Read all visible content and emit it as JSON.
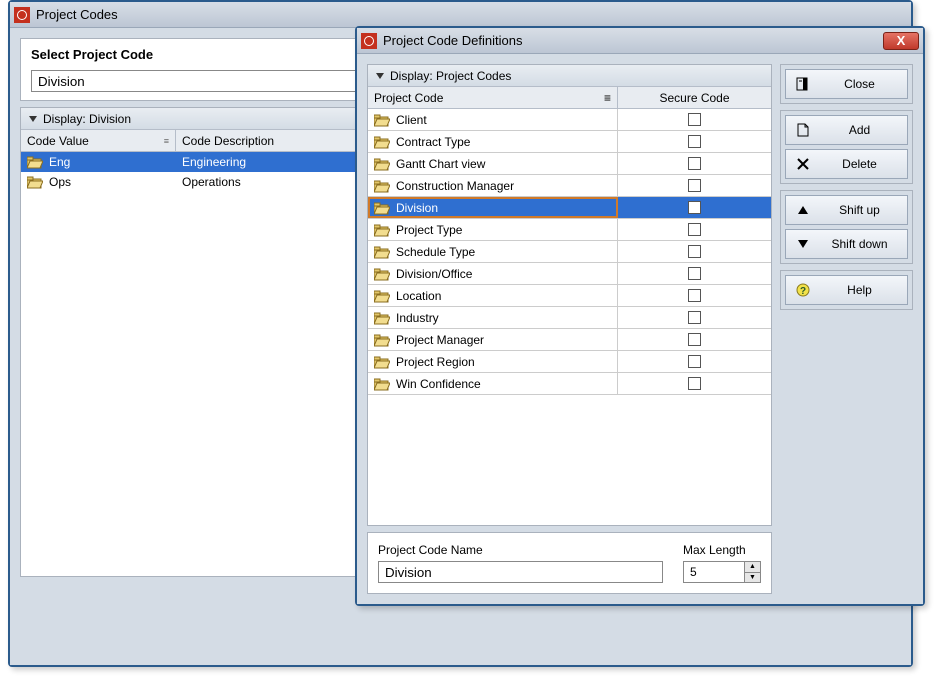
{
  "back_window": {
    "title": "Project Codes",
    "select_label": "Select Project Code",
    "select_value": "Division",
    "display_label": "Display: Division",
    "columns": {
      "value": "Code Value",
      "desc": "Code Description"
    },
    "rows": [
      {
        "value": "Eng",
        "desc": "Engineering",
        "selected": true
      },
      {
        "value": "Ops",
        "desc": "Operations",
        "selected": false
      }
    ]
  },
  "front_window": {
    "title": "Project Code Definitions",
    "close_x": "X",
    "display_label": "Display: Project Codes",
    "columns": {
      "code": "Project Code",
      "secure": "Secure Code"
    },
    "codes": [
      {
        "name": "Client",
        "secure": false,
        "selected": false
      },
      {
        "name": "Contract Type",
        "secure": false,
        "selected": false
      },
      {
        "name": "Gantt Chart view",
        "secure": false,
        "selected": false
      },
      {
        "name": "Construction Manager",
        "secure": false,
        "selected": false
      },
      {
        "name": "Division",
        "secure": false,
        "selected": true
      },
      {
        "name": "Project Type",
        "secure": false,
        "selected": false
      },
      {
        "name": "Schedule Type",
        "secure": false,
        "selected": false
      },
      {
        "name": "Division/Office",
        "secure": false,
        "selected": false
      },
      {
        "name": "Location",
        "secure": false,
        "selected": false
      },
      {
        "name": "Industry",
        "secure": false,
        "selected": false
      },
      {
        "name": "Project Manager",
        "secure": false,
        "selected": false
      },
      {
        "name": "Project Region",
        "secure": false,
        "selected": false
      },
      {
        "name": "Win Confidence",
        "secure": false,
        "selected": false
      }
    ],
    "name_label": "Project Code Name",
    "name_value": "Division",
    "maxlen_label": "Max Length",
    "maxlen_value": "5",
    "buttons": {
      "close": "Close",
      "add": "Add",
      "delete": "Delete",
      "shiftup": "Shift up",
      "shiftdown": "Shift down",
      "help": "Help"
    }
  }
}
